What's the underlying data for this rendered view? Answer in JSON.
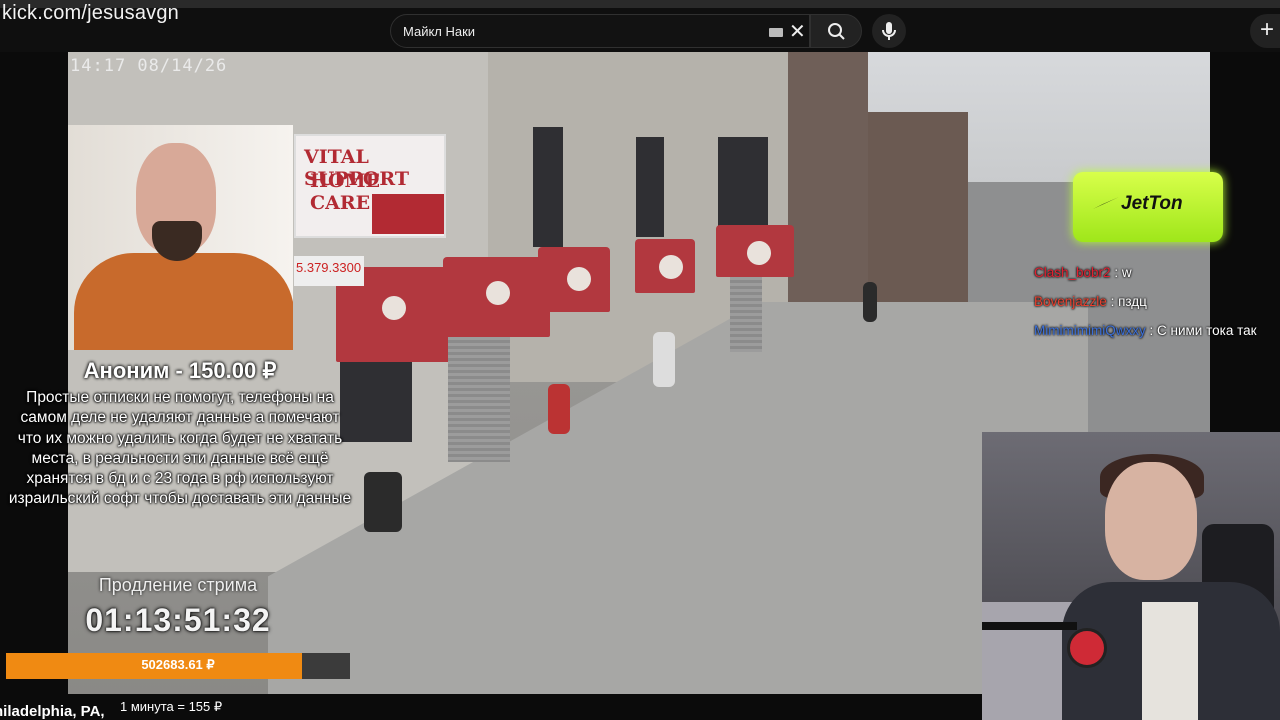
{
  "browser": {
    "url_overlay": "kick.com/jesusavgn",
    "search": {
      "value": "Майкл Наки"
    }
  },
  "stream": {
    "cctv_timestamp": "14:17  08/14/26",
    "sign": {
      "line1": "VITAL SUPPORT",
      "line2": "HOME CARE",
      "phone": "5.379.3300"
    },
    "location": "hiladelphia, PA,"
  },
  "donation": {
    "title": "Аноним - 150.00 ₽",
    "message": "Простые отписки не помогут, телефоны на самом деле не удаляют данные а помечают что их можно удалить когда будет не хватать места, в реальности эти данные всё ещё хранятся в бд и с 23 года в рф используют израильский софт чтобы доставать эти данные"
  },
  "extension": {
    "label": "Продление стрима",
    "timer": "01:13:51:32",
    "total_label": "502683.61 ₽",
    "progress_fraction": 0.86,
    "rate": "1 минута = 155 ₽"
  },
  "sponsor": {
    "name": "JetTon",
    "color": "#c6ff2e"
  },
  "chat": [
    {
      "user": "Clash_bobr2",
      "message": ": w",
      "color": "#e02030"
    },
    {
      "user": "Bovenjazzle",
      "message": ": пздц",
      "color": "#e8402f"
    },
    {
      "user": "MimimimimiQwxxy",
      "message": ": С ними тока так",
      "color": "#3b6fd8"
    }
  ],
  "icons": [
    "keyboard-icon",
    "close-icon",
    "search-icon",
    "mic-icon",
    "plus-icon"
  ],
  "colors": {
    "accent_orange": "#f08a12",
    "awning_red": "#b2383f"
  }
}
